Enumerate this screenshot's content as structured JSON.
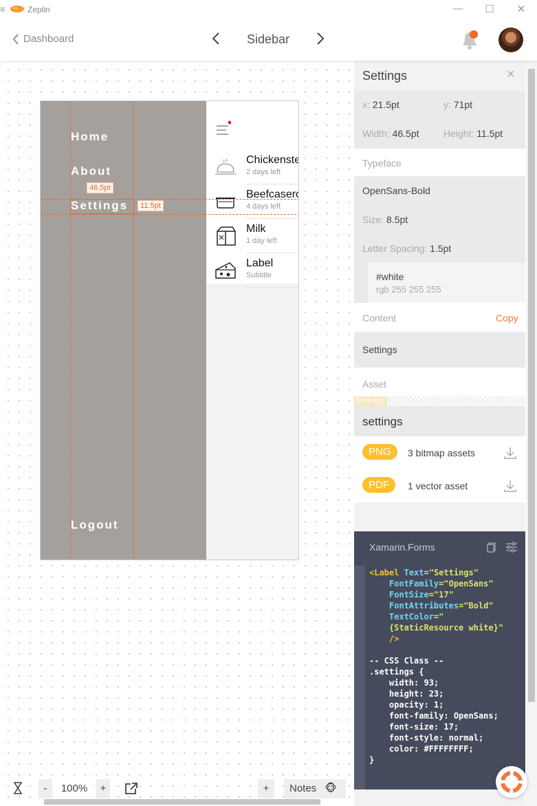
{
  "app": {
    "name": "Zeplin",
    "menu_glyph": "≡",
    "minimize": "—",
    "maximize": "☐",
    "close": "✕"
  },
  "header": {
    "back_label": "Dashboard",
    "title": "Sidebar",
    "prev": "‹",
    "next": "›"
  },
  "artboard": {
    "menu": [
      "Home",
      "About",
      "Settings",
      "Logout"
    ],
    "items": [
      {
        "title": "Chickenstew",
        "subtitle": "2 days left"
      },
      {
        "title": "Beefcaserole",
        "subtitle": "4 days left"
      },
      {
        "title": "Milk",
        "subtitle": "1 day left"
      },
      {
        "title": "Label",
        "subtitle": "Subtitle"
      }
    ],
    "width_measure": "46.5pt",
    "height_measure": "11.5pt"
  },
  "panel": {
    "title": "Settings",
    "close": "×",
    "x_label": "x:",
    "x_value": "21.5pt",
    "y_label": "y:",
    "y_value": "71pt",
    "width_label": "Width:",
    "width_value": "46.5pt",
    "height_label": "Height:",
    "height_value": "11.5pt",
    "typeface_label": "Typeface",
    "font_name": "OpenSans-Bold",
    "size_label": "Size:",
    "size_value": "8.5pt",
    "spacing_label": "Letter Spacing:",
    "spacing_value": "1.5pt",
    "color_name": "#white",
    "color_rgb": "rgb 255 255 255",
    "content_label": "Content",
    "copy_label": "Copy",
    "content_value": "Settings",
    "asset_label": "Asset",
    "asset_preview": "Settings",
    "asset_name": "settings",
    "png_badge": "PNG",
    "png_desc": "3 bitmap assets",
    "pdf_badge": "PDF",
    "pdf_desc": "1 vector asset"
  },
  "code": {
    "platform": "Xamarin.Forms",
    "xaml": [
      "<Label",
      "Text",
      "=\"Settings\"",
      "FontFamily",
      "=\"OpenSans\"",
      "FontSize",
      "=\"17\"",
      "FontAttributes",
      "=\"Bold\"",
      "TextColor",
      "=\"",
      "{StaticResource white}\"",
      "/>"
    ],
    "css": [
      "-- CSS Class --",
      ".settings {",
      "    width: 93;",
      "    height: 23;",
      "    opacity: 1;",
      "    font-family: OpenSans;",
      "    font-size: 17;",
      "    font-style: normal;",
      "    color: #FFFFFFFF;",
      "}"
    ]
  },
  "toolbar": {
    "minus": "-",
    "zoom": "100%",
    "plus": "+",
    "add": "+",
    "notes": "Notes",
    "notes_emoji": "🐵"
  },
  "colors": {
    "accent": "#e36b2a",
    "sidebar": "#a5a09b",
    "badge": "#fcbf2e",
    "code_bg": "#454b5c"
  }
}
